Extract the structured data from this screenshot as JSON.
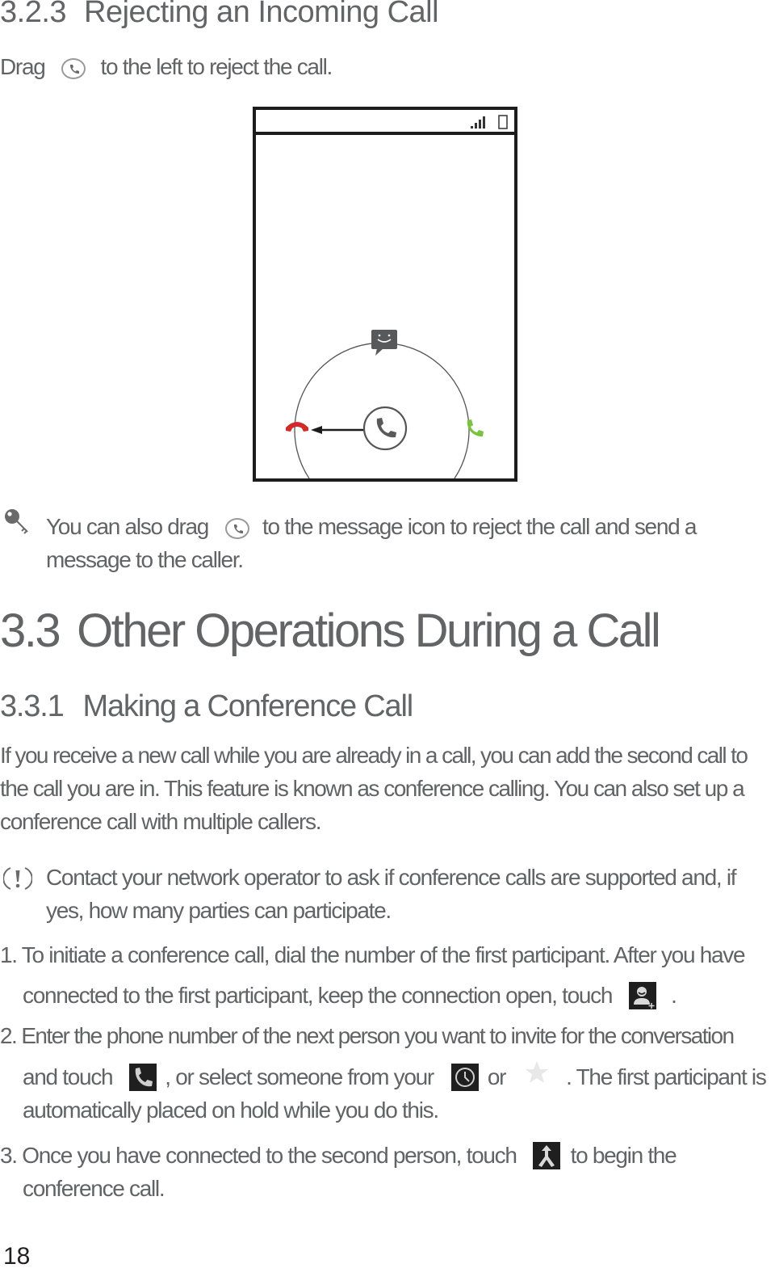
{
  "section_323": {
    "number": "3.2.3",
    "title": "Rejecting an Incoming Call",
    "instruction_prefix": "Drag",
    "instruction_suffix": "to the left to reject the call."
  },
  "phone_illustration": {
    "status_icons": [
      "signal-icon",
      "battery-icon"
    ],
    "lock_ring": {
      "top": "message-icon",
      "left": "reject-call-icon",
      "right": "answer-call-icon",
      "center": "phone-handle-icon"
    },
    "colors": {
      "reject": "#d22a2a",
      "answer": "#7cc242",
      "ring": "#555555",
      "handle": "#58595b"
    }
  },
  "tip": {
    "icon": "tip-key-icon",
    "line1_prefix": "You can also drag",
    "line1_suffix": "to the message icon to reject the call and send a",
    "line2": "message to the caller."
  },
  "section_33": {
    "number": "3.3",
    "title": "Other Operations During a Call"
  },
  "section_331": {
    "number": "3.3.1",
    "title": "Making a Conference Call",
    "paragraph": [
      "If you receive a new call while you are already in a call, you can add the second call to",
      "the call you are in. This feature is known as conference calling. You can also set up a",
      "conference call with multiple callers."
    ]
  },
  "note": {
    "icon": "warning-icon",
    "line1": "Contact your network operator to ask if conference calls are supported and, if",
    "line2": "yes, how many parties can participate."
  },
  "steps": [
    {
      "number": "1.",
      "line1": "To initiate a conference call, dial the number of the first participant. After you have",
      "line2_prefix": "connected to the first participant, keep the connection open, touch",
      "line2_suffix": "."
    },
    {
      "number": "2.",
      "line1": "Enter the phone number of the next person you want to invite for the conversation",
      "line2_a": "and touch",
      "line2_b": ", or select someone from your",
      "line2_c": "or",
      "line2_d": ". The first participant is",
      "line3": "automatically placed on hold while you do this."
    },
    {
      "number": "3.",
      "line1_prefix": "Once you have connected to the second person, touch",
      "line1_suffix": "to begin the",
      "line2": "conference call."
    }
  ],
  "page_number": "18"
}
